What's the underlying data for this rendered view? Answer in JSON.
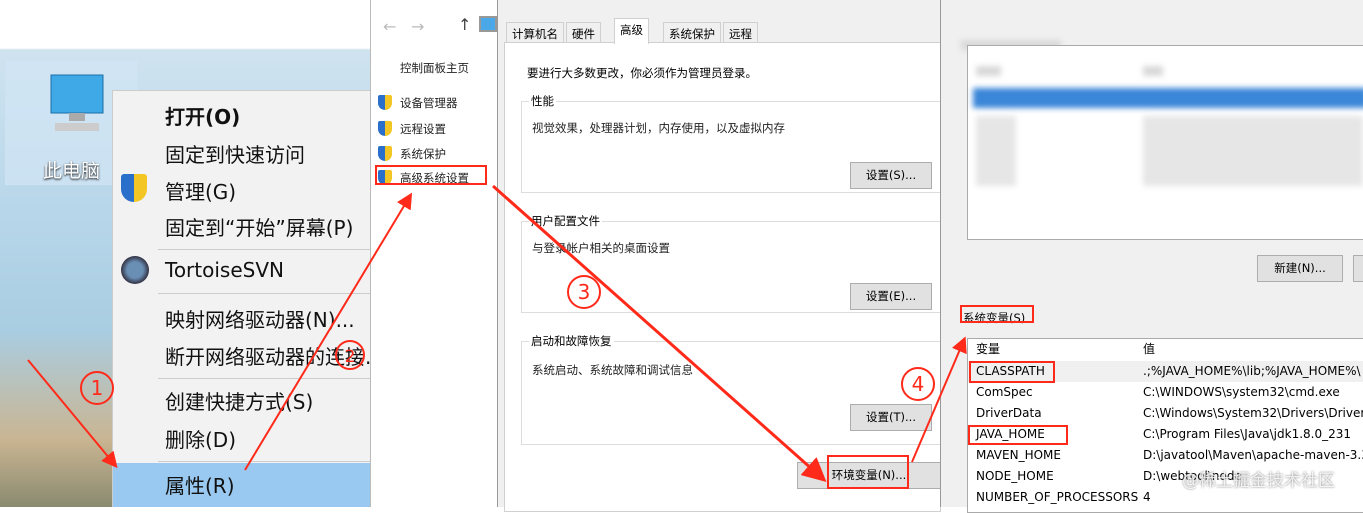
{
  "desktop": {
    "icon_label": "此电脑"
  },
  "context_menu": {
    "items": [
      "打开(O)",
      "固定到快速访问",
      "管理(G)",
      "固定到“开始”屏幕(P)",
      "TortoiseSVN",
      "映射网络驱动器(N)...",
      "断开网络驱动器的连接...",
      "创建快捷方式(S)",
      "删除(D)",
      "属性(R)"
    ]
  },
  "control_panel": {
    "home": "控制面板主页",
    "items": [
      "设备管理器",
      "远程设置",
      "系统保护",
      "高级系统设置"
    ]
  },
  "system_properties": {
    "tabs": [
      "计算机名",
      "硬件",
      "高级",
      "系统保护",
      "远程"
    ],
    "active_tab": "高级",
    "admin_note": "要进行大多数更改，你必须作为管理员登录。",
    "groups": [
      {
        "title": "性能",
        "desc": "视觉效果，处理器计划，内存使用，以及虚拟内存",
        "button": "设置(S)..."
      },
      {
        "title": "用户配置文件",
        "desc": "与登录帐户相关的桌面设置",
        "button": "设置(E)..."
      },
      {
        "title": "启动和故障恢复",
        "desc": "系统启动、系统故障和调试信息",
        "button": "设置(T)..."
      }
    ],
    "env_button": "环境变量(N)..."
  },
  "env_vars": {
    "new_button": "新建(N)...",
    "system_label": "系统变量(S)",
    "headers": [
      "变量",
      "值"
    ],
    "rows": [
      [
        "CLASSPATH",
        ".;%JAVA_HOME%\\lib;%JAVA_HOME%\\"
      ],
      [
        "ComSpec",
        "C:\\WINDOWS\\system32\\cmd.exe"
      ],
      [
        "DriverData",
        "C:\\Windows\\System32\\Drivers\\DriverD"
      ],
      [
        "JAVA_HOME",
        "C:\\Program Files\\Java\\jdk1.8.0_231"
      ],
      [
        "MAVEN_HOME",
        "D:\\javatool\\Maven\\apache-maven-3.3."
      ],
      [
        "NODE_HOME",
        "D:\\webtool\\node"
      ],
      [
        "NUMBER_OF_PROCESSORS",
        "4"
      ]
    ]
  },
  "annotations": {
    "steps": [
      "1",
      "2",
      "3",
      "4"
    ],
    "color": "#ff2a1a"
  },
  "watermark": "@稀土掘金技术社区"
}
